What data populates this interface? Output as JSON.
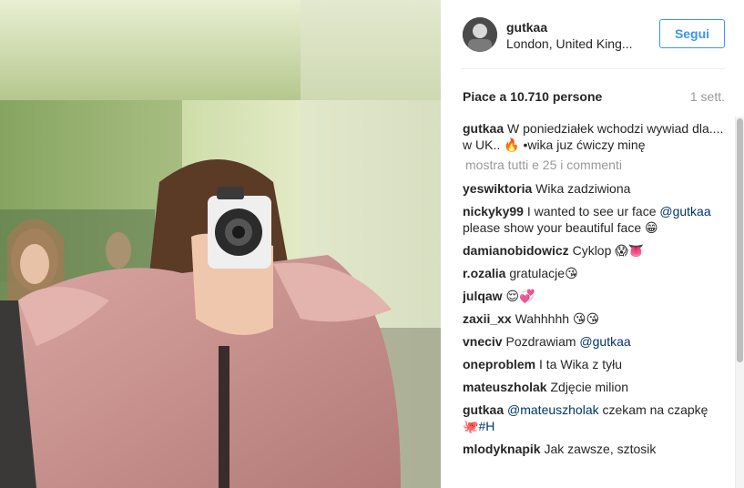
{
  "post": {
    "author": "gutkaa",
    "location": "London, United King...",
    "follow_label": "Segui",
    "likes_text": "Piace a 10.710 persone",
    "age_text": "1 sett."
  },
  "caption": {
    "user": "gutkaa",
    "text": "W poniedziałek wchodzi wywiad dla.... w UK.. 🔥 •wika juz ćwiczy minę"
  },
  "show_all_label": "mostra tutti e 25 i commenti",
  "comments": [
    {
      "user": "yeswiktoria",
      "text": "Wika zadziwiona",
      "mention": ""
    },
    {
      "user": "nickyky99",
      "text": "I wanted to see ur face",
      "mention": "@gutkaa",
      "text2": "please show your beautiful face 😁"
    },
    {
      "user": "damianobidowicz",
      "text": "Cyklop 😱👅",
      "mention": ""
    },
    {
      "user": "r.ozalia",
      "text": "gratulacje😘",
      "mention": ""
    },
    {
      "user": "julqaw",
      "text": "😌💞",
      "mention": ""
    },
    {
      "user": "zaxii_xx",
      "text": "Wahhhhh 😘😘",
      "mention": ""
    },
    {
      "user": "vneciv",
      "text": "Pozdrawiam",
      "mention": "@gutkaa"
    },
    {
      "user": "oneproblem",
      "text": "I ta Wika z tyłu",
      "mention": ""
    },
    {
      "user": "mateuszholak",
      "text": "Zdjęcie milion",
      "mention": ""
    },
    {
      "user": "gutkaa",
      "text": "",
      "mention": "@mateuszholak",
      "text2": "czekam na czapkę 🐙",
      "tag": "#H"
    },
    {
      "user": "mlodyknapik",
      "text": "Jak zawsze, sztosik",
      "mention": ""
    }
  ]
}
